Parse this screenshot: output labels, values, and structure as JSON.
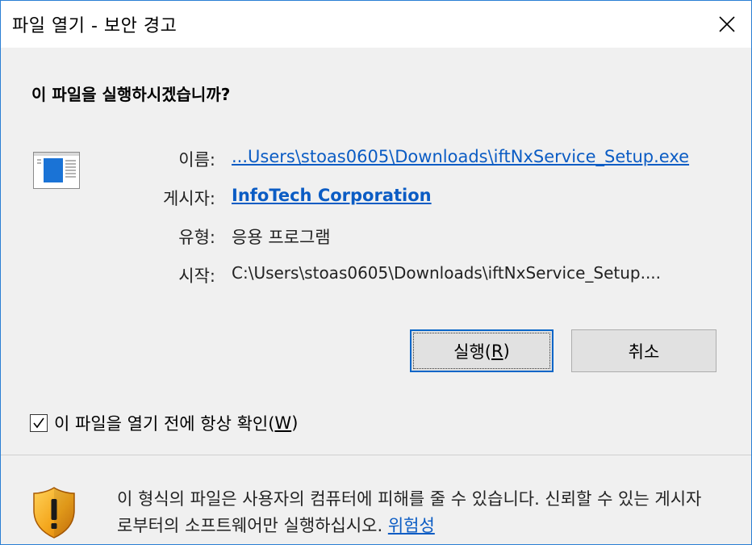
{
  "window": {
    "title": "파일 열기 - 보안 경고",
    "close_label": "✕"
  },
  "dialog": {
    "question": "이 파일을 실행하시겠습니까?",
    "fields": {
      "name_label": "이름:",
      "name_value": "...Users\\stoas0605\\Downloads\\iftNxService_Setup.exe",
      "publisher_label": "게시자:",
      "publisher_value": "InfoTech Corporation",
      "type_label": "유형:",
      "type_value": "응용 프로그램",
      "from_label": "시작:",
      "from_value": "C:\\Users\\stoas0605\\Downloads\\iftNxService_Setup...."
    },
    "buttons": {
      "run_label_pre": "실행(",
      "run_mnemonic": "R",
      "run_label_post": ")",
      "cancel_label": "취소"
    },
    "checkbox": {
      "checked": true,
      "label_pre": "이 파일을 열기 전에 항상 확인(",
      "mnemonic": "W",
      "label_post": ")"
    }
  },
  "footer": {
    "warning_text": "이 형식의 파일은 사용자의 컴퓨터에 피해를 줄 수 있습니다. 신뢰할 수 있는 게시자로부터의 소프트웨어만 실행하십시오. ",
    "risk_link": "위험성"
  },
  "icons": {
    "app": "application-window-icon",
    "shield": "warning-shield-icon",
    "close": "close-icon",
    "check": "checkmark-icon"
  },
  "colors": {
    "link": "#0b5cc4",
    "border_accent": "#2a7fd4",
    "default_button_border": "#0a66c8"
  }
}
